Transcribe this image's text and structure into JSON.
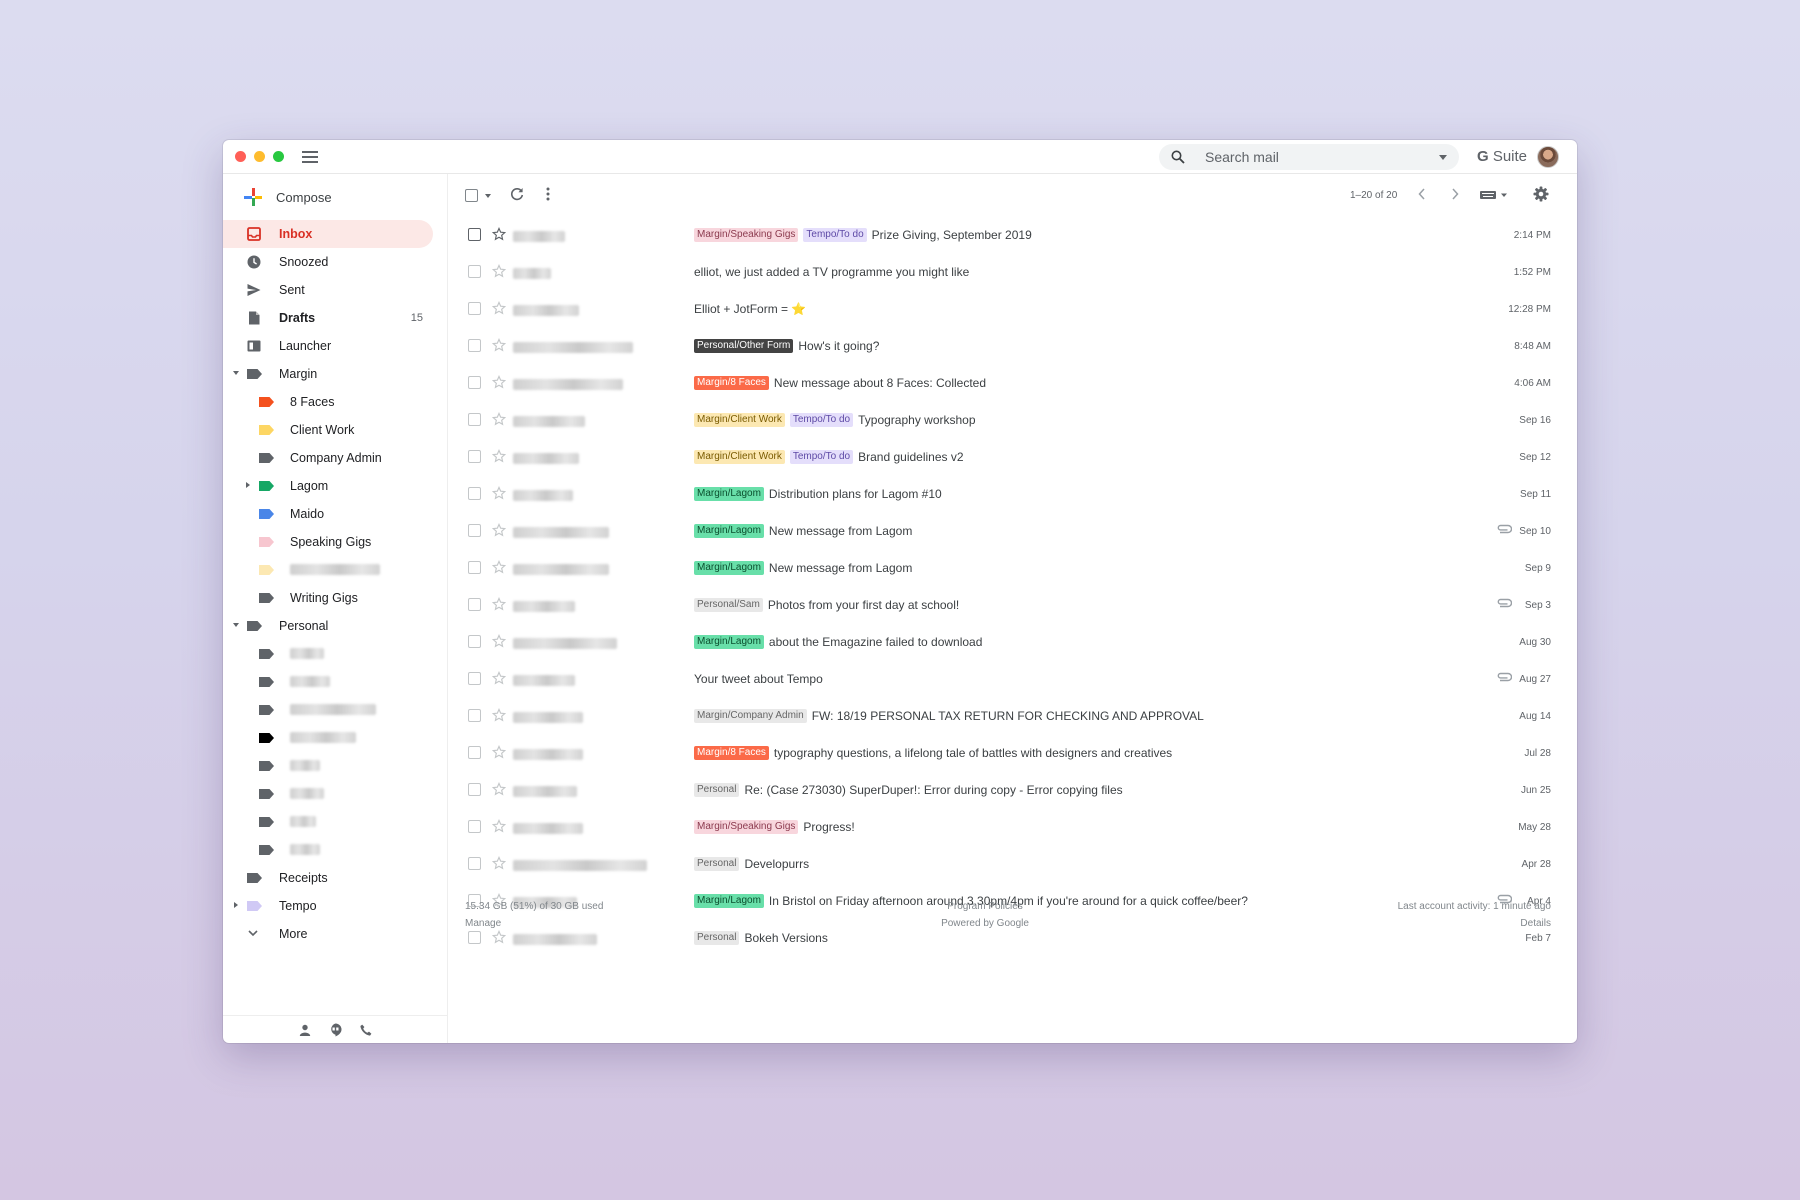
{
  "search": {
    "placeholder": "Search mail"
  },
  "brand": {
    "g": "G",
    "suite": " Suite"
  },
  "compose": {
    "label": "Compose"
  },
  "nav": [
    {
      "label": "Inbox",
      "icon": "inbox-icon",
      "active": true
    },
    {
      "label": "Snoozed",
      "icon": "clock-icon"
    },
    {
      "label": "Sent",
      "icon": "send-icon"
    },
    {
      "label": "Drafts",
      "icon": "draft-icon",
      "count": "15",
      "bold": true
    },
    {
      "label": "Launcher",
      "icon": "launcher-icon"
    },
    {
      "label": "Margin",
      "icon": "label-icon",
      "expanded": true
    },
    {
      "label": "8 Faces",
      "icon": "label-icon",
      "color": "#f4511e",
      "sub": true
    },
    {
      "label": "Client Work",
      "icon": "label-icon",
      "color": "#fdd663",
      "sub": true
    },
    {
      "label": "Company Admin",
      "icon": "label-icon",
      "color": "#5f6368",
      "sub": true
    },
    {
      "label": "Lagom",
      "icon": "label-icon",
      "color": "#16a765",
      "sub": true,
      "collapsed": true
    },
    {
      "label": "Maido",
      "icon": "label-icon",
      "color": "#4a86e8",
      "sub": true
    },
    {
      "label": "Speaking Gigs",
      "icon": "label-icon",
      "color": "#f7c6cf",
      "sub": true
    },
    {
      "label": "",
      "icon": "label-icon",
      "color": "#fce8b2",
      "sub": true,
      "blurred": 90
    },
    {
      "label": "Writing Gigs",
      "icon": "label-icon",
      "color": "#5f6368",
      "sub": true
    },
    {
      "label": "Personal",
      "icon": "label-icon",
      "expanded": true
    },
    {
      "label": "",
      "icon": "label-icon",
      "color": "#5f6368",
      "sub": true,
      "blurred": 34
    },
    {
      "label": "",
      "icon": "label-icon",
      "color": "#5f6368",
      "sub": true,
      "blurred": 40
    },
    {
      "label": "",
      "icon": "label-icon",
      "color": "#5f6368",
      "sub": true,
      "blurred": 86
    },
    {
      "label": "",
      "icon": "label-icon",
      "color": "#000000",
      "sub": true,
      "blurred": 66
    },
    {
      "label": "",
      "icon": "label-icon",
      "color": "#5f6368",
      "sub": true,
      "blurred": 30
    },
    {
      "label": "",
      "icon": "label-icon",
      "color": "#5f6368",
      "sub": true,
      "blurred": 34
    },
    {
      "label": "",
      "icon": "label-icon",
      "color": "#5f6368",
      "sub": true,
      "blurred": 26
    },
    {
      "label": "",
      "icon": "label-icon",
      "color": "#5f6368",
      "sub": true,
      "blurred": 30
    },
    {
      "label": "Receipts",
      "icon": "label-icon"
    },
    {
      "label": "Tempo",
      "icon": "label-icon",
      "color": "#d0c9f5",
      "collapsed": true
    },
    {
      "label": "More",
      "icon": "chevron-down-icon"
    }
  ],
  "toolbar": {
    "range": "1–20 of 20"
  },
  "emails": [
    {
      "sender_w": 52,
      "chips": [
        {
          "t": "Margin/Speaking Gigs",
          "bg": "#f8d6dd",
          "fg": "#8b3a4e"
        },
        {
          "t": "Tempo/To do",
          "bg": "#e4defb",
          "fg": "#5e4aa6"
        }
      ],
      "subject": "Prize Giving, September 2019",
      "date": "2:14 PM"
    },
    {
      "sender_w": 38,
      "chips": [],
      "subject": "elliot, we just added a TV programme you might like",
      "date": "1:52 PM"
    },
    {
      "sender_w": 66,
      "chips": [],
      "subject": "Elliot + JotForm = ⭐",
      "date": "12:28 PM"
    },
    {
      "sender_w": 120,
      "chips": [
        {
          "t": "Personal/Other Form",
          "bg": "#434343",
          "fg": "#ffffff"
        }
      ],
      "subject": "How's it going?",
      "date": "8:48 AM"
    },
    {
      "sender_w": 110,
      "chips": [
        {
          "t": "Margin/8 Faces",
          "bg": "#fb6a48",
          "fg": "#ffffff"
        }
      ],
      "subject": "New message about 8 Faces: Collected",
      "date": "4:06 AM"
    },
    {
      "sender_w": 72,
      "chips": [
        {
          "t": "Margin/Client Work",
          "bg": "#fce8b2",
          "fg": "#7a5b00"
        },
        {
          "t": "Tempo/To do",
          "bg": "#e4defb",
          "fg": "#5e4aa6"
        }
      ],
      "subject": "Typography workshop",
      "date": "Sep 16"
    },
    {
      "sender_w": 66,
      "chips": [
        {
          "t": "Margin/Client Work",
          "bg": "#fce8b2",
          "fg": "#7a5b00"
        },
        {
          "t": "Tempo/To do",
          "bg": "#e4defb",
          "fg": "#5e4aa6"
        }
      ],
      "subject": "Brand guidelines v2",
      "date": "Sep 12"
    },
    {
      "sender_w": 60,
      "chips": [
        {
          "t": "Margin/Lagom",
          "bg": "#68dfa9",
          "fg": "#0b4f2e"
        }
      ],
      "subject": "Distribution plans for Lagom #10",
      "date": "Sep 11"
    },
    {
      "sender_w": 96,
      "chips": [
        {
          "t": "Margin/Lagom",
          "bg": "#68dfa9",
          "fg": "#0b4f2e"
        }
      ],
      "subject": "New message from Lagom",
      "date": "Sep 10",
      "attach": true
    },
    {
      "sender_w": 96,
      "chips": [
        {
          "t": "Margin/Lagom",
          "bg": "#68dfa9",
          "fg": "#0b4f2e"
        }
      ],
      "subject": "New message from Lagom",
      "date": "Sep 9"
    },
    {
      "sender_w": 62,
      "chips": [
        {
          "t": "Personal/Sam",
          "bg": "#e8e8e8",
          "fg": "#666666"
        }
      ],
      "subject": "Photos from your first day at school!",
      "date": "Sep 3",
      "attach": true
    },
    {
      "sender_w": 104,
      "chips": [
        {
          "t": "Margin/Lagom",
          "bg": "#68dfa9",
          "fg": "#0b4f2e"
        }
      ],
      "subject": "about the Emagazine failed to download",
      "date": "Aug 30"
    },
    {
      "sender_w": 62,
      "chips": [],
      "subject": "Your tweet about Tempo",
      "date": "Aug 27",
      "attach": true
    },
    {
      "sender_w": 70,
      "chips": [
        {
          "t": "Margin/Company Admin",
          "bg": "#e8e8e8",
          "fg": "#666666"
        }
      ],
      "subject": "FW: 18/19 PERSONAL TAX RETURN FOR CHECKING AND APPROVAL",
      "date": "Aug 14"
    },
    {
      "sender_w": 70,
      "chips": [
        {
          "t": "Margin/8 Faces",
          "bg": "#fb6a48",
          "fg": "#ffffff"
        }
      ],
      "subject": "typography questions, a lifelong tale of battles with designers and creatives",
      "date": "Jul 28"
    },
    {
      "sender_w": 64,
      "chips": [
        {
          "t": "Personal",
          "bg": "#e8e8e8",
          "fg": "#666666"
        }
      ],
      "subject": "Re: (Case 273030) SuperDuper!: Error during copy - Error copying files",
      "date": "Jun 25"
    },
    {
      "sender_w": 70,
      "chips": [
        {
          "t": "Margin/Speaking Gigs",
          "bg": "#f8d6dd",
          "fg": "#8b3a4e"
        }
      ],
      "subject": "Progress!",
      "date": "May 28"
    },
    {
      "sender_w": 134,
      "chips": [
        {
          "t": "Personal",
          "bg": "#e8e8e8",
          "fg": "#666666"
        }
      ],
      "subject": "Developurrs",
      "date": "Apr 28"
    },
    {
      "sender_w": 64,
      "chips": [
        {
          "t": "Margin/Lagom",
          "bg": "#68dfa9",
          "fg": "#0b4f2e"
        }
      ],
      "subject": "In Bristol on Friday afternoon around 3.30pm/4pm if you're around for a quick coffee/beer?",
      "date": "Apr 4",
      "attach": true
    },
    {
      "sender_w": 84,
      "chips": [
        {
          "t": "Personal",
          "bg": "#e8e8e8",
          "fg": "#666666"
        }
      ],
      "subject": "Bokeh Versions",
      "date": "Feb 7"
    }
  ],
  "footer": {
    "storage": "15.34 GB (51%) of 30 GB used",
    "manage": "Manage",
    "policies": "Program Policies",
    "powered": "Powered by Google",
    "activity": "Last account activity: 1 minute ago",
    "details": "Details"
  },
  "colors": {
    "accent": "#d93025",
    "active_bg": "#fce8e6"
  }
}
